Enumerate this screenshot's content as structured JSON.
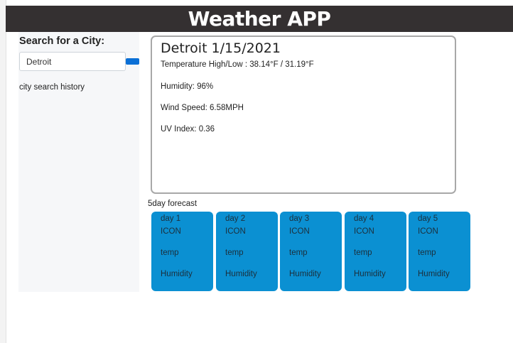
{
  "header": {
    "title": "Weather APP"
  },
  "sidebar": {
    "search_label": "Search for a City:",
    "search_value": "Detroit",
    "history_label": "city search history"
  },
  "current": {
    "title": "Detroit 1/15/2021",
    "temperature": "Temperature High/Low : 38.14°F / 31.19°F",
    "humidity": "Humidity: 96%",
    "wind": "Wind Speed: 6.58MPH",
    "uv": "UV Index: 0.36"
  },
  "forecast": {
    "label": "5day forecast",
    "days": [
      {
        "day": "day 1",
        "icon": "ICON",
        "temp": "temp",
        "humidity": "Humidity"
      },
      {
        "day": "day 2",
        "icon": "ICON",
        "temp": "temp",
        "humidity": "Humidity"
      },
      {
        "day": "day 3",
        "icon": "ICON",
        "temp": "temp",
        "humidity": "Humidity"
      },
      {
        "day": "day 4",
        "icon": "ICON",
        "temp": "temp",
        "humidity": "Humidity"
      },
      {
        "day": "day 5",
        "icon": "ICON",
        "temp": "temp",
        "humidity": "Humidity"
      }
    ]
  },
  "colors": {
    "header_bg": "#343031",
    "card_blue": "#0b90d2",
    "button_blue": "#0a6fd6"
  }
}
